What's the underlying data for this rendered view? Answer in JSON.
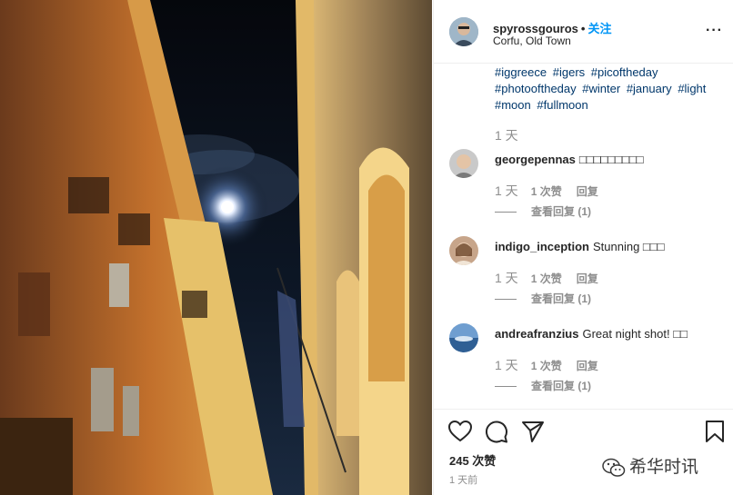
{
  "post": {
    "username": "spyrossgouros",
    "separator": "•",
    "follow_label": "关注",
    "location": "Corfu, Old Town",
    "more_label": "···"
  },
  "caption": {
    "hashtags": [
      "#iggreece",
      "#igers",
      "#picoftheday",
      "#photooftheday",
      "#winter",
      "#january",
      "#light",
      "#moon",
      "#fullmoon"
    ],
    "time": "1 天"
  },
  "comments": [
    {
      "user": "georgepennas",
      "text": "□□□□□□□□□",
      "time": "1 天",
      "likes": "1 次赞",
      "reply": "回复",
      "view_replies": "查看回复 (1)"
    },
    {
      "user": "indigo_inception",
      "text": "Stunning □□□",
      "time": "1 天",
      "likes": "1 次赞",
      "reply": "回复",
      "view_replies": "查看回复 (1)"
    },
    {
      "user": "andreafranzius",
      "text": "Great night shot! □□",
      "time": "1 天",
      "likes": "1 次赞",
      "reply": "回复",
      "view_replies": "查看回复 (1)"
    }
  ],
  "footer": {
    "likes_count": "245 次赞",
    "post_time": "1 天前",
    "watermark": "希华时讯"
  },
  "icons": {
    "like": "heart-icon",
    "comment": "comment-icon",
    "share": "send-icon",
    "save": "bookmark-icon",
    "watermark": "wechat-icon"
  },
  "colors": {
    "follow": "#0095f6",
    "hashtag": "#00376b",
    "muted": "#8e8e8e"
  }
}
